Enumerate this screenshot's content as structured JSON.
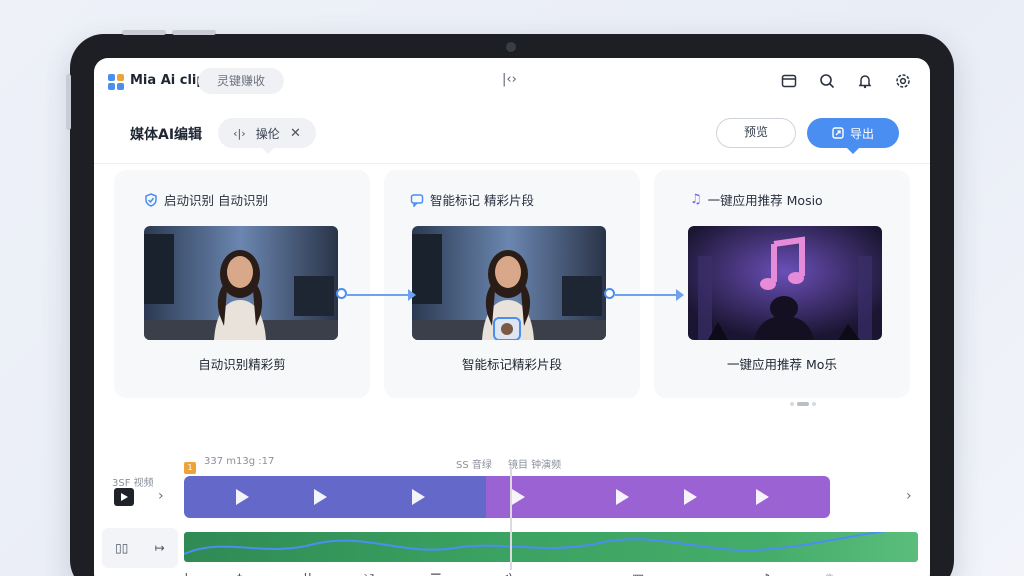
{
  "app": {
    "title": "Mia Ai clip",
    "search_placeholder": "灵键赚收",
    "center_mark": "|‹›"
  },
  "header": {
    "page_title": "媒体AI编辑",
    "chip_label": "操伦",
    "secondary_button": "预览",
    "primary_button": "导出"
  },
  "cards": [
    {
      "head": "启动识别 自动识别",
      "caption": "自动识别精彩剪",
      "icon": "shield-check-icon"
    },
    {
      "head": "智能标记 精彩片段",
      "caption": "智能标记精彩片段",
      "icon": "chat-icon"
    },
    {
      "head": "一键应用推荐 Mosio",
      "caption": "一键应用推荐 Mo乐",
      "icon": "music-note-icon"
    }
  ],
  "timeline": {
    "left_label": "3SF 视频",
    "time_label": "337 m13g  :17",
    "right_label": "SS 音绿",
    "right_label_2": "镜目 钟演频"
  },
  "colors": {
    "accent": "#4a8ef2",
    "clip_a": "#6468c8",
    "clip_b": "#9a62d2",
    "audio": "#3aa160"
  }
}
